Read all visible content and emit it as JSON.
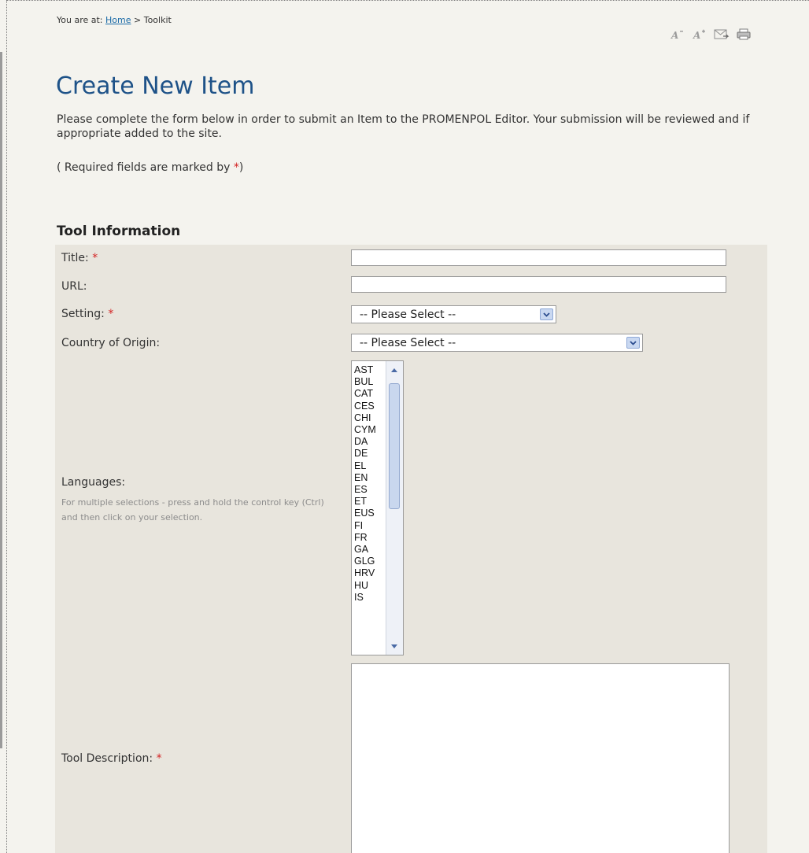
{
  "breadcrumb": {
    "prefix": "You are at:",
    "home_link": "Home",
    "separator": ">",
    "current": "Toolkit"
  },
  "toolbar": {
    "icons": [
      "decrease-font-icon",
      "increase-font-icon",
      "email-icon",
      "print-icon"
    ]
  },
  "page": {
    "title": "Create New Item",
    "intro": "Please complete the form below in order to submit an Item to the PROMENPOL Editor. Your submission will be reviewed and if appropriate added to the site.",
    "required_note_before": "( Required fields are marked by ",
    "required_star": "*",
    "required_note_after": ")"
  },
  "form": {
    "section_title": "Tool Information",
    "title_label": "Title:",
    "title_value": "",
    "url_label": "URL:",
    "url_value": "",
    "setting_label": "Setting:",
    "setting_value": "-- Please Select --",
    "country_label": "Country of Origin:",
    "country_value": "-- Please Select --",
    "languages_label": "Languages:",
    "languages_hint": "For multiple selections - press and hold the control key (Ctrl) and then click on your selection.",
    "languages_options": [
      "AST",
      "BUL",
      "CAT",
      "CES",
      "CHI",
      "CYM",
      "DA",
      "DE",
      "EL",
      "EN",
      "ES",
      "ET",
      "EUS",
      "FI",
      "FR",
      "GA",
      "GLG",
      "HRV",
      "HU",
      "IS"
    ],
    "description_label": "Tool Description:",
    "description_value": "",
    "required_star": "*"
  },
  "colors": {
    "title_blue": "#1e5288",
    "link_blue": "#1a6aa7",
    "required_red": "#d32222",
    "panel_bg": "#e8e5dd",
    "page_bg": "#f4f3ee"
  }
}
